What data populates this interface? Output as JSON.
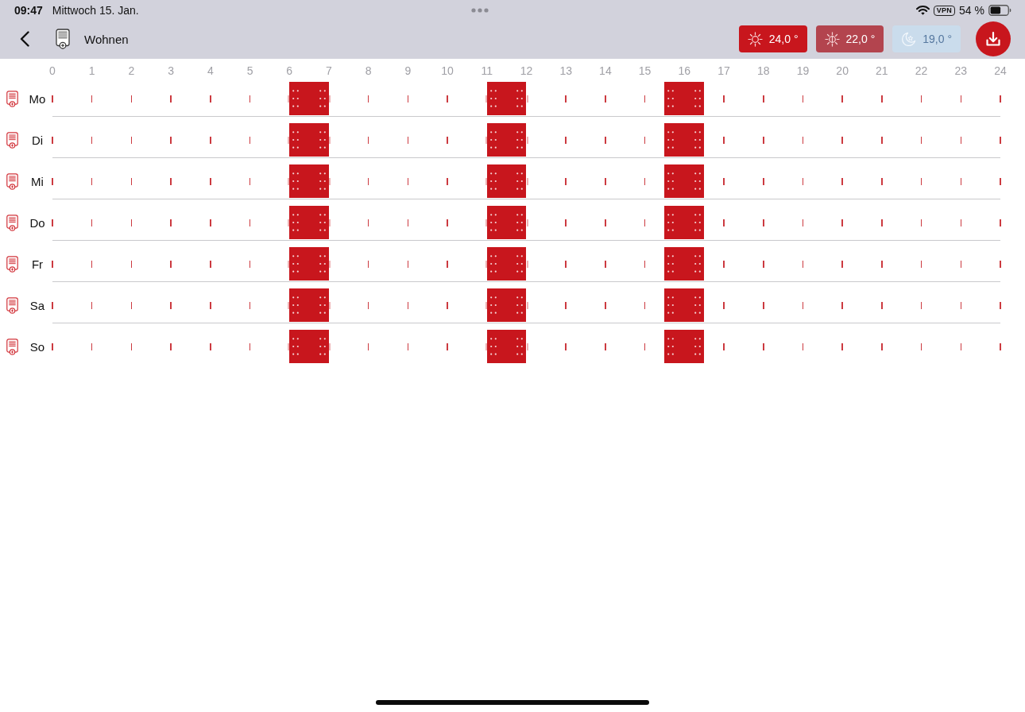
{
  "status_bar": {
    "time": "09:47",
    "date": "Mittwoch 15. Jan.",
    "vpn": "VPN",
    "battery": "54 %"
  },
  "nav_bar": {
    "title": "Wohnen",
    "presets": [
      {
        "kind": "sun",
        "label": "24,0 °",
        "color": "#c8161d"
      },
      {
        "kind": "sun-half",
        "label": "22,0 °",
        "color": "#b3444e"
      },
      {
        "kind": "moon",
        "label": "19,0 °",
        "color": "#cadcec"
      }
    ]
  },
  "schedule": {
    "hours": [
      "0",
      "1",
      "2",
      "3",
      "4",
      "5",
      "6",
      "7",
      "8",
      "9",
      "10",
      "11",
      "12",
      "13",
      "14",
      "15",
      "16",
      "17",
      "18",
      "19",
      "20",
      "21",
      "22",
      "23",
      "24"
    ],
    "days": [
      {
        "label": "Mo",
        "slots": [
          {
            "heating": false
          },
          {
            "heating": false
          },
          {
            "heating": false
          },
          {
            "heating": false
          },
          {
            "heating": false
          },
          {
            "heating": false
          },
          {
            "heating": false
          },
          {
            "heating": false
          },
          {
            "heating": false
          },
          {
            "heating": false
          },
          {
            "heating": false
          },
          {
            "heating": false
          },
          {
            "heating": true
          },
          {
            "heating": true
          },
          {
            "heating": false
          },
          {
            "heating": false
          },
          {
            "heating": false
          },
          {
            "heating": false
          },
          {
            "heating": false
          },
          {
            "heating": false
          },
          {
            "heating": false
          },
          {
            "heating": false
          },
          {
            "heating": true
          },
          {
            "heating": true
          },
          {
            "heating": false
          },
          {
            "heating": false
          },
          {
            "heating": false
          },
          {
            "heating": false
          },
          {
            "heating": false
          },
          {
            "heating": false
          },
          {
            "heating": false
          },
          {
            "heating": true
          },
          {
            "heating": true
          },
          {
            "heating": false
          },
          {
            "heating": false
          },
          {
            "heating": false
          },
          {
            "heating": false
          },
          {
            "heating": false
          },
          {
            "heating": false
          },
          {
            "heating": false
          },
          {
            "heating": false
          },
          {
            "heating": false
          },
          {
            "heating": false
          },
          {
            "heating": false
          },
          {
            "heating": false
          },
          {
            "heating": false
          },
          {
            "heating": false
          },
          {
            "heating": false
          }
        ]
      },
      {
        "label": "Di",
        "slots": [
          {
            "heating": false
          },
          {
            "heating": false
          },
          {
            "heating": false
          },
          {
            "heating": false
          },
          {
            "heating": false
          },
          {
            "heating": false
          },
          {
            "heating": false
          },
          {
            "heating": false
          },
          {
            "heating": false
          },
          {
            "heating": false
          },
          {
            "heating": false
          },
          {
            "heating": false
          },
          {
            "heating": true
          },
          {
            "heating": true
          },
          {
            "heating": false
          },
          {
            "heating": false
          },
          {
            "heating": false
          },
          {
            "heating": false
          },
          {
            "heating": false
          },
          {
            "heating": false
          },
          {
            "heating": false
          },
          {
            "heating": false
          },
          {
            "heating": true
          },
          {
            "heating": true
          },
          {
            "heating": false
          },
          {
            "heating": false
          },
          {
            "heating": false
          },
          {
            "heating": false
          },
          {
            "heating": false
          },
          {
            "heating": false
          },
          {
            "heating": false
          },
          {
            "heating": true
          },
          {
            "heating": true
          },
          {
            "heating": false
          },
          {
            "heating": false
          },
          {
            "heating": false
          },
          {
            "heating": false
          },
          {
            "heating": false
          },
          {
            "heating": false
          },
          {
            "heating": false
          },
          {
            "heating": false
          },
          {
            "heating": false
          },
          {
            "heating": false
          },
          {
            "heating": false
          },
          {
            "heating": false
          },
          {
            "heating": false
          },
          {
            "heating": false
          },
          {
            "heating": false
          }
        ]
      },
      {
        "label": "Mi",
        "slots": [
          {
            "heating": false
          },
          {
            "heating": false
          },
          {
            "heating": false
          },
          {
            "heating": false
          },
          {
            "heating": false
          },
          {
            "heating": false
          },
          {
            "heating": false
          },
          {
            "heating": false
          },
          {
            "heating": false
          },
          {
            "heating": false
          },
          {
            "heating": false
          },
          {
            "heating": false
          },
          {
            "heating": true
          },
          {
            "heating": true
          },
          {
            "heating": false
          },
          {
            "heating": false
          },
          {
            "heating": false
          },
          {
            "heating": false
          },
          {
            "heating": false
          },
          {
            "heating": false
          },
          {
            "heating": false
          },
          {
            "heating": false
          },
          {
            "heating": true
          },
          {
            "heating": true
          },
          {
            "heating": false
          },
          {
            "heating": false
          },
          {
            "heating": false
          },
          {
            "heating": false
          },
          {
            "heating": false
          },
          {
            "heating": false
          },
          {
            "heating": false
          },
          {
            "heating": true
          },
          {
            "heating": true
          },
          {
            "heating": false
          },
          {
            "heating": false
          },
          {
            "heating": false
          },
          {
            "heating": false
          },
          {
            "heating": false
          },
          {
            "heating": false
          },
          {
            "heating": false
          },
          {
            "heating": false
          },
          {
            "heating": false
          },
          {
            "heating": false
          },
          {
            "heating": false
          },
          {
            "heating": false
          },
          {
            "heating": false
          },
          {
            "heating": false
          },
          {
            "heating": false
          }
        ]
      },
      {
        "label": "Do",
        "slots": [
          {
            "heating": false
          },
          {
            "heating": false
          },
          {
            "heating": false
          },
          {
            "heating": false
          },
          {
            "heating": false
          },
          {
            "heating": false
          },
          {
            "heating": false
          },
          {
            "heating": false
          },
          {
            "heating": false
          },
          {
            "heating": false
          },
          {
            "heating": false
          },
          {
            "heating": false
          },
          {
            "heating": true
          },
          {
            "heating": true
          },
          {
            "heating": false
          },
          {
            "heating": false
          },
          {
            "heating": false
          },
          {
            "heating": false
          },
          {
            "heating": false
          },
          {
            "heating": false
          },
          {
            "heating": false
          },
          {
            "heating": false
          },
          {
            "heating": true
          },
          {
            "heating": true
          },
          {
            "heating": false
          },
          {
            "heating": false
          },
          {
            "heating": false
          },
          {
            "heating": false
          },
          {
            "heating": false
          },
          {
            "heating": false
          },
          {
            "heating": false
          },
          {
            "heating": true
          },
          {
            "heating": true
          },
          {
            "heating": false
          },
          {
            "heating": false
          },
          {
            "heating": false
          },
          {
            "heating": false
          },
          {
            "heating": false
          },
          {
            "heating": false
          },
          {
            "heating": false
          },
          {
            "heating": false
          },
          {
            "heating": false
          },
          {
            "heating": false
          },
          {
            "heating": false
          },
          {
            "heating": false
          },
          {
            "heating": false
          },
          {
            "heating": false
          },
          {
            "heating": false
          }
        ]
      },
      {
        "label": "Fr",
        "slots": [
          {
            "heating": false
          },
          {
            "heating": false
          },
          {
            "heating": false
          },
          {
            "heating": false
          },
          {
            "heating": false
          },
          {
            "heating": false
          },
          {
            "heating": false
          },
          {
            "heating": false
          },
          {
            "heating": false
          },
          {
            "heating": false
          },
          {
            "heating": false
          },
          {
            "heating": false
          },
          {
            "heating": true
          },
          {
            "heating": true
          },
          {
            "heating": false
          },
          {
            "heating": false
          },
          {
            "heating": false
          },
          {
            "heating": false
          },
          {
            "heating": false
          },
          {
            "heating": false
          },
          {
            "heating": false
          },
          {
            "heating": false
          },
          {
            "heating": true
          },
          {
            "heating": true
          },
          {
            "heating": false
          },
          {
            "heating": false
          },
          {
            "heating": false
          },
          {
            "heating": false
          },
          {
            "heating": false
          },
          {
            "heating": false
          },
          {
            "heating": false
          },
          {
            "heating": true
          },
          {
            "heating": true
          },
          {
            "heating": false
          },
          {
            "heating": false
          },
          {
            "heating": false
          },
          {
            "heating": false
          },
          {
            "heating": false
          },
          {
            "heating": false
          },
          {
            "heating": false
          },
          {
            "heating": false
          },
          {
            "heating": false
          },
          {
            "heating": false
          },
          {
            "heating": false
          },
          {
            "heating": false
          },
          {
            "heating": false
          },
          {
            "heating": false
          },
          {
            "heating": false
          }
        ]
      },
      {
        "label": "Sa",
        "slots": [
          {
            "heating": false
          },
          {
            "heating": false
          },
          {
            "heating": false
          },
          {
            "heating": false
          },
          {
            "heating": false
          },
          {
            "heating": false
          },
          {
            "heating": false
          },
          {
            "heating": false
          },
          {
            "heating": false
          },
          {
            "heating": false
          },
          {
            "heating": false
          },
          {
            "heating": false
          },
          {
            "heating": true
          },
          {
            "heating": true
          },
          {
            "heating": false
          },
          {
            "heating": false
          },
          {
            "heating": false
          },
          {
            "heating": false
          },
          {
            "heating": false
          },
          {
            "heating": false
          },
          {
            "heating": false
          },
          {
            "heating": false
          },
          {
            "heating": true
          },
          {
            "heating": true
          },
          {
            "heating": false
          },
          {
            "heating": false
          },
          {
            "heating": false
          },
          {
            "heating": false
          },
          {
            "heating": false
          },
          {
            "heating": false
          },
          {
            "heating": false
          },
          {
            "heating": true
          },
          {
            "heating": true
          },
          {
            "heating": false
          },
          {
            "heating": false
          },
          {
            "heating": false
          },
          {
            "heating": false
          },
          {
            "heating": false
          },
          {
            "heating": false
          },
          {
            "heating": false
          },
          {
            "heating": false
          },
          {
            "heating": false
          },
          {
            "heating": false
          },
          {
            "heating": false
          },
          {
            "heating": false
          },
          {
            "heating": false
          },
          {
            "heating": false
          },
          {
            "heating": false
          }
        ]
      },
      {
        "label": "So",
        "slots": [
          {
            "heating": false
          },
          {
            "heating": false
          },
          {
            "heating": false
          },
          {
            "heating": false
          },
          {
            "heating": false
          },
          {
            "heating": false
          },
          {
            "heating": false
          },
          {
            "heating": false
          },
          {
            "heating": false
          },
          {
            "heating": false
          },
          {
            "heating": false
          },
          {
            "heating": false
          },
          {
            "heating": true
          },
          {
            "heating": true
          },
          {
            "heating": false
          },
          {
            "heating": false
          },
          {
            "heating": false
          },
          {
            "heating": false
          },
          {
            "heating": false
          },
          {
            "heating": false
          },
          {
            "heating": false
          },
          {
            "heating": false
          },
          {
            "heating": true
          },
          {
            "heating": true
          },
          {
            "heating": false
          },
          {
            "heating": false
          },
          {
            "heating": false
          },
          {
            "heating": false
          },
          {
            "heating": false
          },
          {
            "heating": false
          },
          {
            "heating": false
          },
          {
            "heating": true
          },
          {
            "heating": true
          },
          {
            "heating": false
          },
          {
            "heating": false
          },
          {
            "heating": false
          },
          {
            "heating": false
          },
          {
            "heating": false
          },
          {
            "heating": false
          },
          {
            "heating": false
          },
          {
            "heating": false
          },
          {
            "heating": false
          },
          {
            "heating": false
          },
          {
            "heating": false
          },
          {
            "heating": false
          },
          {
            "heating": false
          },
          {
            "heating": false
          },
          {
            "heating": false
          }
        ]
      }
    ]
  }
}
